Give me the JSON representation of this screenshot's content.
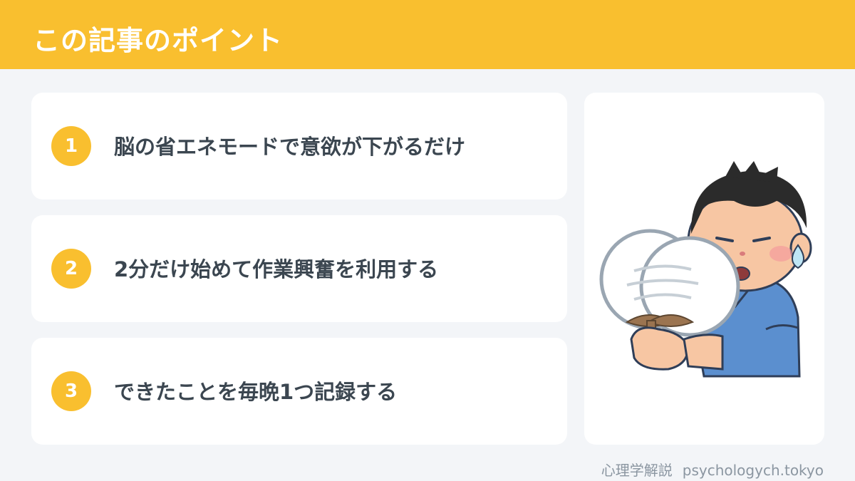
{
  "header": {
    "title": "この記事のポイント"
  },
  "points": [
    {
      "number": "1",
      "text": "脳の省エネモードで意欲が下がるだけ"
    },
    {
      "number": "2",
      "text": "2分だけ始めて作業興奮を利用する"
    },
    {
      "number": "3",
      "text": "できたことを毎晩1つ記録する"
    }
  ],
  "illustration": {
    "icon": "tired-man-fanning-icon"
  },
  "footer": {
    "site_name": "心理学解説",
    "domain": "psychologych.tokyo"
  },
  "colors": {
    "accent": "#f9bf2f",
    "background": "#f3f5f8",
    "text": "#3b4650",
    "muted": "#8b96a1"
  }
}
